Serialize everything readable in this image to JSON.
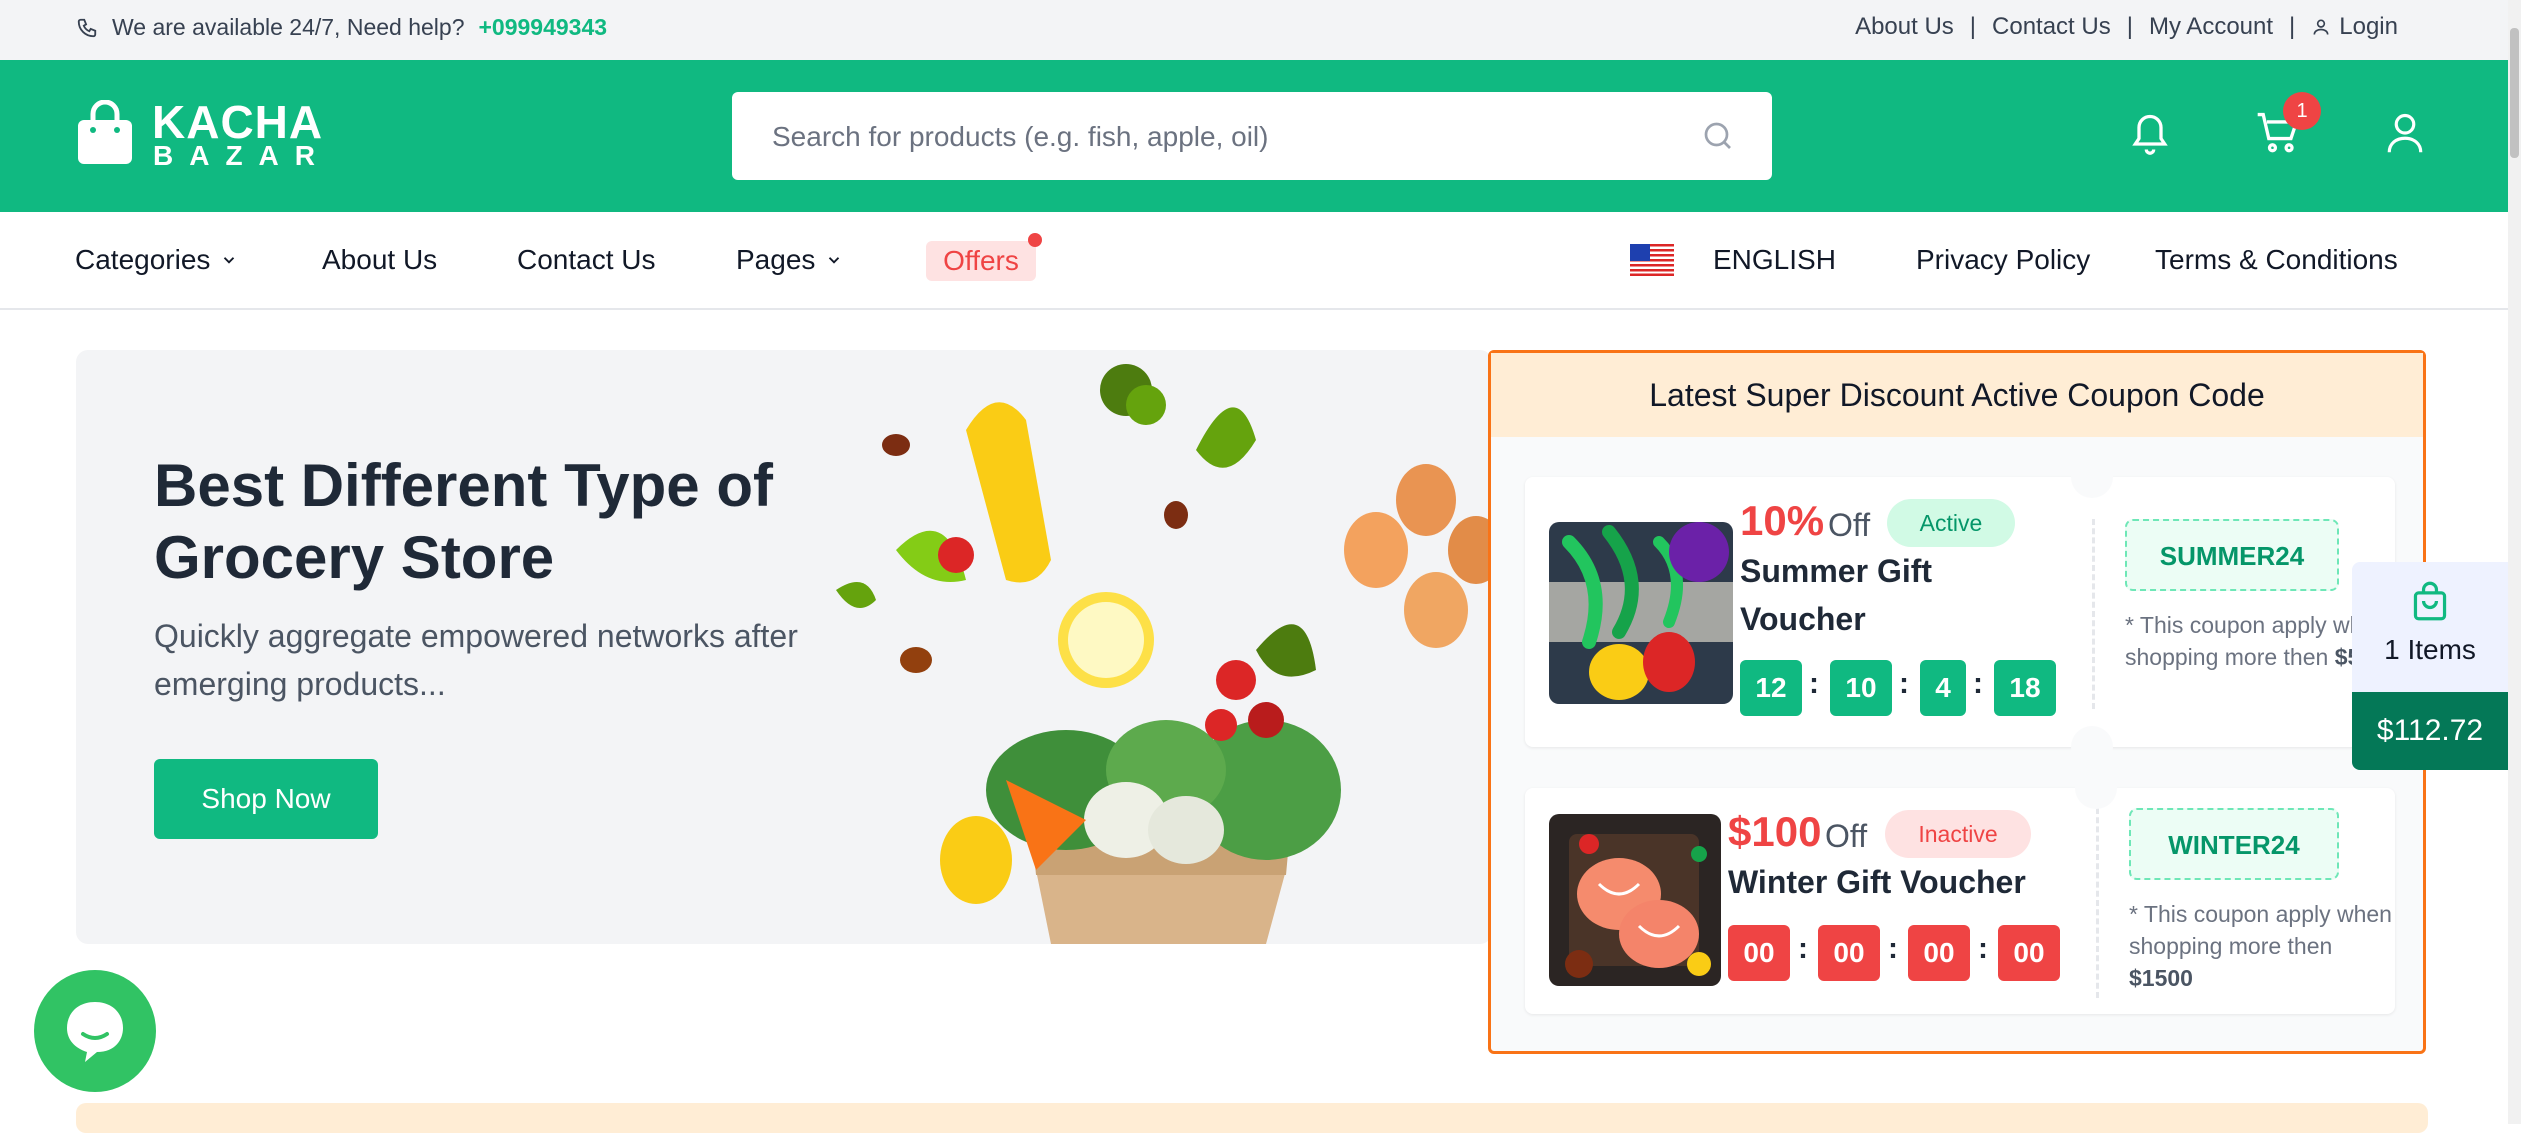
{
  "topbar": {
    "help_text": "We are available 24/7, Need help?",
    "phone": "+099949343",
    "links": [
      "About Us",
      "Contact Us",
      "My Account",
      "Login"
    ]
  },
  "header": {
    "logo_line1": "KACHA",
    "logo_line2": "BAZAR",
    "search_placeholder": "Search for products (e.g. fish, apple, oil)",
    "cart_count": "1",
    "icons": [
      "bell-icon",
      "cart-icon",
      "user-icon"
    ]
  },
  "nav": {
    "categories": "Categories",
    "about": "About Us",
    "contact": "Contact Us",
    "pages": "Pages",
    "offers": "Offers",
    "language": "ENGLISH",
    "privacy": "Privacy Policy",
    "terms": "Terms & Conditions"
  },
  "hero": {
    "title": "Best Different Type of Grocery Store",
    "subtitle": "Quickly aggregate empowered networks after emerging products...",
    "button": "Shop Now"
  },
  "coupons": {
    "heading": "Latest Super Discount Active Coupon Code",
    "items": [
      {
        "discount": "10%",
        "off": "Off",
        "status": "Active",
        "title": "Summer Gift Voucher",
        "timer": [
          "12",
          "10",
          "4",
          "18"
        ],
        "code": "SUMMER24",
        "note": "* This coupon apply when shopping more then",
        "min": "$500"
      },
      {
        "discount": "$100",
        "off": "Off",
        "status": "Inactive",
        "title": "Winter Gift Voucher",
        "timer": [
          "00",
          "00",
          "00",
          "00"
        ],
        "code": "WINTER24",
        "note": "* This coupon apply when shopping more then",
        "min": "$1500"
      }
    ]
  },
  "floating_cart": {
    "items": "1 Items",
    "total": "$112.72"
  },
  "colors": {
    "brand": "#10b981",
    "danger": "#ef4444",
    "coupon_border": "#f97316"
  }
}
